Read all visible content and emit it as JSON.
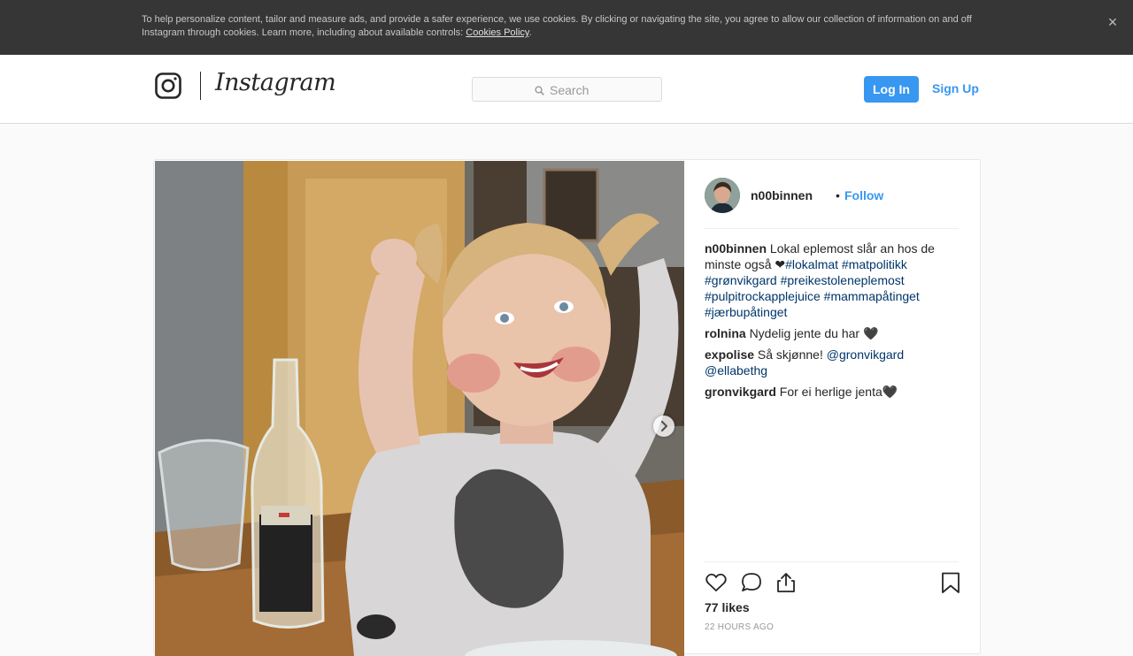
{
  "cookie_banner": {
    "text": "To help personalize content, tailor and measure ads, and provide a safer experience, we use cookies. By clicking or navigating the site, you agree to allow our collection of information on and off Instagram through cookies. Learn more, including about available controls: ",
    "link_text": "Cookies Policy",
    "period": ".",
    "close_glyph": "×"
  },
  "header": {
    "wordmark": "Instagram",
    "search_placeholder": "Search",
    "login_label": "Log In",
    "signup_label": "Sign Up"
  },
  "post": {
    "author": "n00binnen",
    "separator": "•",
    "follow_label": "Follow",
    "caption": {
      "text": "Lokal eplemost slår an hos de minste også ❤",
      "hashtags": [
        "#lokalmat",
        "#matpolitikk",
        "#grønvikgard",
        "#preikestoleneplemost",
        "#pulpitrockapplejuice",
        "#mammapåtinget",
        "#jærbupåtinget"
      ]
    },
    "comments": [
      {
        "user": "rolnina",
        "text": "Nydelig jente du har ",
        "tail": "🖤"
      },
      {
        "user": "expolise",
        "text": "Så skjønne! ",
        "mentions": [
          "@gronvikgard",
          "@ellabethg"
        ]
      },
      {
        "user": "gronvikgard",
        "text": "For ei herlige jenta",
        "tail": "🖤"
      }
    ],
    "likes": "77 likes",
    "time": "22 HOURS AGO"
  },
  "colors": {
    "accent": "#3897f0",
    "link": "#003569",
    "banner": "#363636"
  }
}
